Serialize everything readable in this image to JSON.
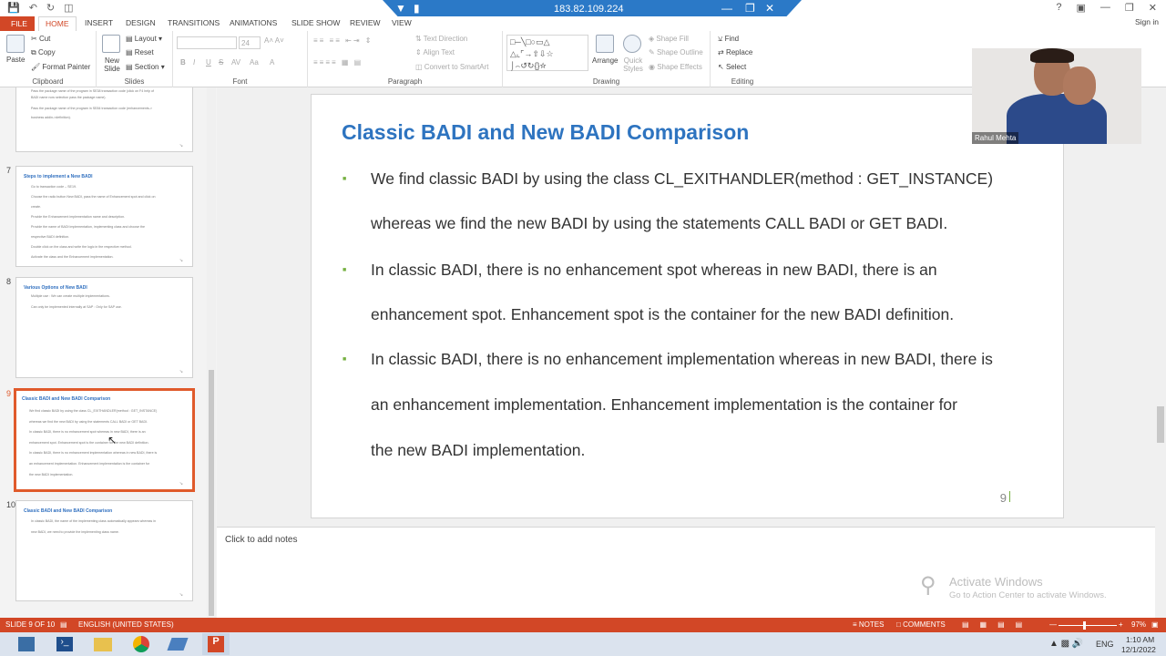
{
  "remote_bar": {
    "ip": "183.82.109.224"
  },
  "ribbon_tabs": [
    "FILE",
    "HOME",
    "INSERT",
    "DESIGN",
    "TRANSITIONS",
    "ANIMATIONS",
    "SLIDE SHOW",
    "REVIEW",
    "VIEW"
  ],
  "signin": "Sign in",
  "clipboard": {
    "paste": "Paste",
    "cut": "Cut",
    "copy": "Copy",
    "format_painter": "Format Painter",
    "label": "Clipboard"
  },
  "slides_group": {
    "new_slide": "New Slide",
    "layout": "Layout",
    "reset": "Reset",
    "section": "Section",
    "label": "Slides"
  },
  "font_group": {
    "size": "24",
    "label": "Font",
    "bold": "B",
    "italic": "I",
    "underline": "U",
    "strike": "S",
    "spacing": "AV",
    "case": "Aa"
  },
  "paragraph_group": {
    "text_direction": "Text Direction",
    "align_text": "Align Text",
    "smartart": "Convert to SmartArt",
    "label": "Paragraph"
  },
  "drawing_group": {
    "arrange": "Arrange",
    "quick_styles": "Quick Styles",
    "shape_fill": "Shape Fill",
    "shape_outline": "Shape Outline",
    "shape_effects": "Shape Effects",
    "label": "Drawing"
  },
  "editing_group": {
    "find": "Find",
    "replace": "Replace",
    "select": "Select",
    "label": "Editing"
  },
  "thumbnails": [
    {
      "num": "",
      "title": "",
      "lines": [
        "Pass the package name of the program in SE38 transaction code (click on F4 help of",
        "BADI name now selection pass the package name).",
        "Pass the package name of the program in SE84 transaction code (enhancements->",
        "business addin->definition)."
      ]
    },
    {
      "num": "7",
      "title": "Steps to implement a New BADI",
      "lines": [
        "Go to transaction code – SE19.",
        "Choose the radio button New BADI, pass the name of Enhancement spot and click on",
        "create.",
        "Provide the Enhancement implementation name and description.",
        "Provide the name of BADI implementation, implementing class and choose the",
        "respective BADI definition.",
        "Double click on the class and write the logic in the respective method.",
        "Activate the class and the Enhancement implementation."
      ]
    },
    {
      "num": "8",
      "title": "Various Options of New BADI",
      "lines": [
        "Multiple use : We can create multiple implementations.",
        "Can only be implemented internally at SAP : Only for SAP use."
      ]
    },
    {
      "num": "9",
      "title": "Classic BADI and New BADI Comparison",
      "lines": [
        "We find classic BADI by using the class CL_EXITHANDLER(method : GET_INSTANCE)",
        "whereas we find the new BADI by using the statements CALL BADI or GET BADI.",
        "In classic BADI, there is no enhancement spot whereas in new BADI, there is an",
        "enhancement spot. Enhancement spot is the container for the new BADI definition.",
        "In classic BADI, there is no enhancement implementation whereas in new BADI, there is",
        "an enhancement implementation. Enhancement implementation is the container for",
        "the new BADI implementation."
      ]
    },
    {
      "num": "10",
      "title": "Classic BADI and New BADI Comparison",
      "lines": [
        "In classic BADI, the name of the implementing class automatically appears whereas in",
        "new BADI, we need to provide the implementing class name."
      ]
    }
  ],
  "slide": {
    "title": "Classic BADI and New BADI Comparison",
    "lines": [
      "We find classic BADI by using the class CL_EXITHANDLER(method : GET_INSTANCE)",
      "whereas we find the new BADI by using the statements CALL BADI or GET BADI.",
      "In classic BADI, there is no enhancement spot whereas in new BADI, there is an",
      "enhancement spot. Enhancement spot is the container for the new BADI definition.",
      "In classic BADI, there is no enhancement implementation whereas in new BADI, there is",
      "an enhancement implementation. Enhancement implementation is the container for",
      "the new BADI implementation."
    ],
    "page_number": "9"
  },
  "notes_placeholder": "Click to add notes",
  "webcam": {
    "name": "Rahul Mehta"
  },
  "watermark": {
    "title": "Activate Windows",
    "subtitle": "Go to Action Center to activate Windows."
  },
  "status": {
    "slide": "SLIDE 9 OF 10",
    "language": "ENGLISH (UNITED STATES)",
    "notes": "NOTES",
    "comments": "COMMENTS",
    "zoom": "97%"
  },
  "taskbar": {
    "lang": "ENG",
    "time": "1:10 AM",
    "date": "12/1/2022"
  },
  "colors": {
    "accent": "#d24726",
    "title_blue": "#2e74c0",
    "bullet_green": "#76b041"
  }
}
